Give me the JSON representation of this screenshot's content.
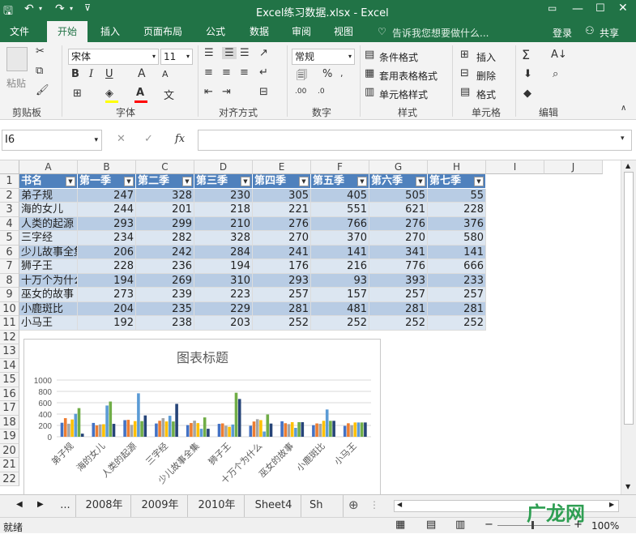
{
  "window": {
    "title": "Excel练习数据.xlsx - Excel"
  },
  "ribbon_tabs": [
    "文件",
    "开始",
    "插入",
    "页面布局",
    "公式",
    "数据",
    "审阅",
    "视图"
  ],
  "tell_me": "告诉我您想要做什么...",
  "login": "登录",
  "share": "共享",
  "ribbon": {
    "paste": "粘贴",
    "font_name": "宋体",
    "font_size": "11",
    "number_format": "常规",
    "conditional_format": "条件格式",
    "table_format": "套用表格格式",
    "cell_style": "单元格样式",
    "insert": "插入",
    "delete": "删除",
    "format": "格式",
    "groups": [
      "剪贴板",
      "字体",
      "对齐方式",
      "数字",
      "样式",
      "单元格",
      "编辑"
    ]
  },
  "formula_bar": {
    "name_box": "I6",
    "fx": "fx",
    "content": ""
  },
  "columns": [
    "A",
    "B",
    "C",
    "D",
    "E",
    "F",
    "G",
    "H",
    "I",
    "J"
  ],
  "rows": [
    "1",
    "2",
    "3",
    "4",
    "5",
    "6",
    "7",
    "8",
    "9",
    "10",
    "11",
    "12",
    "13",
    "14",
    "15",
    "16",
    "17",
    "18",
    "19",
    "20",
    "21",
    "22"
  ],
  "table": {
    "headers": [
      "书名",
      "第一季",
      "第二季",
      "第三季",
      "第四季",
      "第五季",
      "第六季",
      "第七季"
    ],
    "rows": [
      [
        "弟子规",
        "247",
        "328",
        "230",
        "305",
        "405",
        "505",
        "55"
      ],
      [
        "海的女儿",
        "244",
        "201",
        "218",
        "221",
        "551",
        "621",
        "228"
      ],
      [
        "人类的起源",
        "293",
        "299",
        "210",
        "276",
        "766",
        "276",
        "376"
      ],
      [
        "三字经",
        "234",
        "282",
        "328",
        "270",
        "370",
        "270",
        "580"
      ],
      [
        "少儿故事全集",
        "206",
        "242",
        "284",
        "241",
        "141",
        "341",
        "141"
      ],
      [
        "狮子王",
        "228",
        "236",
        "194",
        "176",
        "216",
        "776",
        "666"
      ],
      [
        "十万个为什么",
        "194",
        "269",
        "310",
        "293",
        "93",
        "393",
        "233"
      ],
      [
        "巫女的故事",
        "273",
        "239",
        "223",
        "257",
        "157",
        "257",
        "257"
      ],
      [
        "小鹿斑比",
        "204",
        "235",
        "229",
        "281",
        "481",
        "281",
        "281"
      ],
      [
        "小马王",
        "192",
        "238",
        "203",
        "252",
        "252",
        "252",
        "252"
      ]
    ]
  },
  "chart_data": {
    "type": "bar",
    "title": "图表标题",
    "categories": [
      "弟子规",
      "海的女儿",
      "人类的起源",
      "三字经",
      "少儿故事全集",
      "狮子王",
      "十万个为什么",
      "巫女的故事",
      "小鹿斑比",
      "小马王"
    ],
    "ylim": [
      0,
      1000
    ],
    "yticks": [
      "0",
      "200",
      "400",
      "600",
      "800",
      "1000"
    ],
    "series": [
      {
        "values": [
          247,
          244,
          293,
          234,
          206,
          228,
          194,
          273,
          204,
          192
        ],
        "color": "#4472c4"
      },
      {
        "values": [
          328,
          201,
          299,
          282,
          242,
          236,
          269,
          239,
          235,
          238
        ],
        "color": "#ed7d31"
      },
      {
        "values": [
          230,
          218,
          210,
          328,
          284,
          194,
          310,
          223,
          229,
          203
        ],
        "color": "#a5a5a5"
      },
      {
        "values": [
          305,
          221,
          276,
          270,
          241,
          176,
          293,
          257,
          281,
          252
        ],
        "color": "#ffc000"
      },
      {
        "values": [
          405,
          551,
          766,
          370,
          141,
          216,
          93,
          157,
          481,
          252
        ],
        "color": "#5b9bd5"
      },
      {
        "values": [
          505,
          621,
          276,
          270,
          341,
          776,
          393,
          257,
          281,
          252
        ],
        "color": "#70ad47"
      },
      {
        "values": [
          55,
          228,
          376,
          580,
          141,
          666,
          233,
          257,
          281,
          252
        ],
        "color": "#264478"
      }
    ],
    "grid": true,
    "legend": "none"
  },
  "sheets": [
    "...",
    "2008年",
    "2009年",
    "2010年",
    "Sheet4",
    "Sh"
  ],
  "status": {
    "ready": "就绪",
    "zoom": "100%"
  },
  "watermark": "广龙网"
}
